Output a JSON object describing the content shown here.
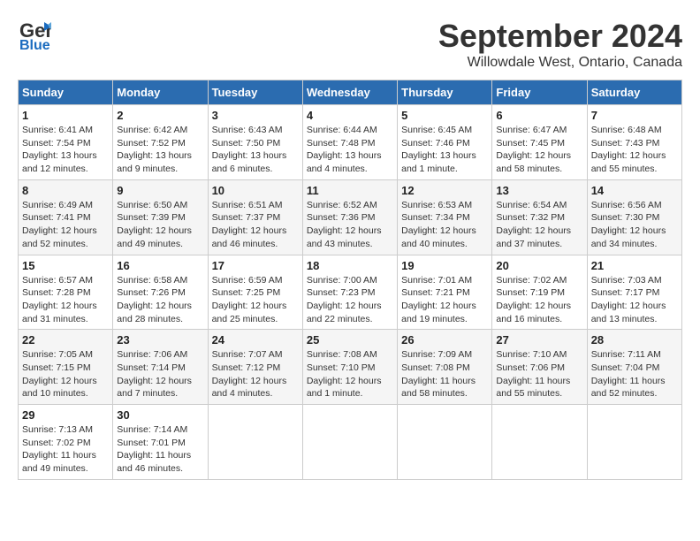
{
  "header": {
    "logo_line1": "General",
    "logo_line2": "Blue",
    "month": "September 2024",
    "location": "Willowdale West, Ontario, Canada"
  },
  "days_of_week": [
    "Sunday",
    "Monday",
    "Tuesday",
    "Wednesday",
    "Thursday",
    "Friday",
    "Saturday"
  ],
  "weeks": [
    [
      {
        "day": 1,
        "sunrise": "6:41 AM",
        "sunset": "7:54 PM",
        "daylight": "13 hours and 12 minutes."
      },
      {
        "day": 2,
        "sunrise": "6:42 AM",
        "sunset": "7:52 PM",
        "daylight": "13 hours and 9 minutes."
      },
      {
        "day": 3,
        "sunrise": "6:43 AM",
        "sunset": "7:50 PM",
        "daylight": "13 hours and 6 minutes."
      },
      {
        "day": 4,
        "sunrise": "6:44 AM",
        "sunset": "7:48 PM",
        "daylight": "13 hours and 4 minutes."
      },
      {
        "day": 5,
        "sunrise": "6:45 AM",
        "sunset": "7:46 PM",
        "daylight": "13 hours and 1 minute."
      },
      {
        "day": 6,
        "sunrise": "6:47 AM",
        "sunset": "7:45 PM",
        "daylight": "12 hours and 58 minutes."
      },
      {
        "day": 7,
        "sunrise": "6:48 AM",
        "sunset": "7:43 PM",
        "daylight": "12 hours and 55 minutes."
      }
    ],
    [
      {
        "day": 8,
        "sunrise": "6:49 AM",
        "sunset": "7:41 PM",
        "daylight": "12 hours and 52 minutes."
      },
      {
        "day": 9,
        "sunrise": "6:50 AM",
        "sunset": "7:39 PM",
        "daylight": "12 hours and 49 minutes."
      },
      {
        "day": 10,
        "sunrise": "6:51 AM",
        "sunset": "7:37 PM",
        "daylight": "12 hours and 46 minutes."
      },
      {
        "day": 11,
        "sunrise": "6:52 AM",
        "sunset": "7:36 PM",
        "daylight": "12 hours and 43 minutes."
      },
      {
        "day": 12,
        "sunrise": "6:53 AM",
        "sunset": "7:34 PM",
        "daylight": "12 hours and 40 minutes."
      },
      {
        "day": 13,
        "sunrise": "6:54 AM",
        "sunset": "7:32 PM",
        "daylight": "12 hours and 37 minutes."
      },
      {
        "day": 14,
        "sunrise": "6:56 AM",
        "sunset": "7:30 PM",
        "daylight": "12 hours and 34 minutes."
      }
    ],
    [
      {
        "day": 15,
        "sunrise": "6:57 AM",
        "sunset": "7:28 PM",
        "daylight": "12 hours and 31 minutes."
      },
      {
        "day": 16,
        "sunrise": "6:58 AM",
        "sunset": "7:26 PM",
        "daylight": "12 hours and 28 minutes."
      },
      {
        "day": 17,
        "sunrise": "6:59 AM",
        "sunset": "7:25 PM",
        "daylight": "12 hours and 25 minutes."
      },
      {
        "day": 18,
        "sunrise": "7:00 AM",
        "sunset": "7:23 PM",
        "daylight": "12 hours and 22 minutes."
      },
      {
        "day": 19,
        "sunrise": "7:01 AM",
        "sunset": "7:21 PM",
        "daylight": "12 hours and 19 minutes."
      },
      {
        "day": 20,
        "sunrise": "7:02 AM",
        "sunset": "7:19 PM",
        "daylight": "12 hours and 16 minutes."
      },
      {
        "day": 21,
        "sunrise": "7:03 AM",
        "sunset": "7:17 PM",
        "daylight": "12 hours and 13 minutes."
      }
    ],
    [
      {
        "day": 22,
        "sunrise": "7:05 AM",
        "sunset": "7:15 PM",
        "daylight": "12 hours and 10 minutes."
      },
      {
        "day": 23,
        "sunrise": "7:06 AM",
        "sunset": "7:14 PM",
        "daylight": "12 hours and 7 minutes."
      },
      {
        "day": 24,
        "sunrise": "7:07 AM",
        "sunset": "7:12 PM",
        "daylight": "12 hours and 4 minutes."
      },
      {
        "day": 25,
        "sunrise": "7:08 AM",
        "sunset": "7:10 PM",
        "daylight": "12 hours and 1 minute."
      },
      {
        "day": 26,
        "sunrise": "7:09 AM",
        "sunset": "7:08 PM",
        "daylight": "11 hours and 58 minutes."
      },
      {
        "day": 27,
        "sunrise": "7:10 AM",
        "sunset": "7:06 PM",
        "daylight": "11 hours and 55 minutes."
      },
      {
        "day": 28,
        "sunrise": "7:11 AM",
        "sunset": "7:04 PM",
        "daylight": "11 hours and 52 minutes."
      }
    ],
    [
      {
        "day": 29,
        "sunrise": "7:13 AM",
        "sunset": "7:02 PM",
        "daylight": "11 hours and 49 minutes."
      },
      {
        "day": 30,
        "sunrise": "7:14 AM",
        "sunset": "7:01 PM",
        "daylight": "11 hours and 46 minutes."
      },
      null,
      null,
      null,
      null,
      null
    ]
  ]
}
